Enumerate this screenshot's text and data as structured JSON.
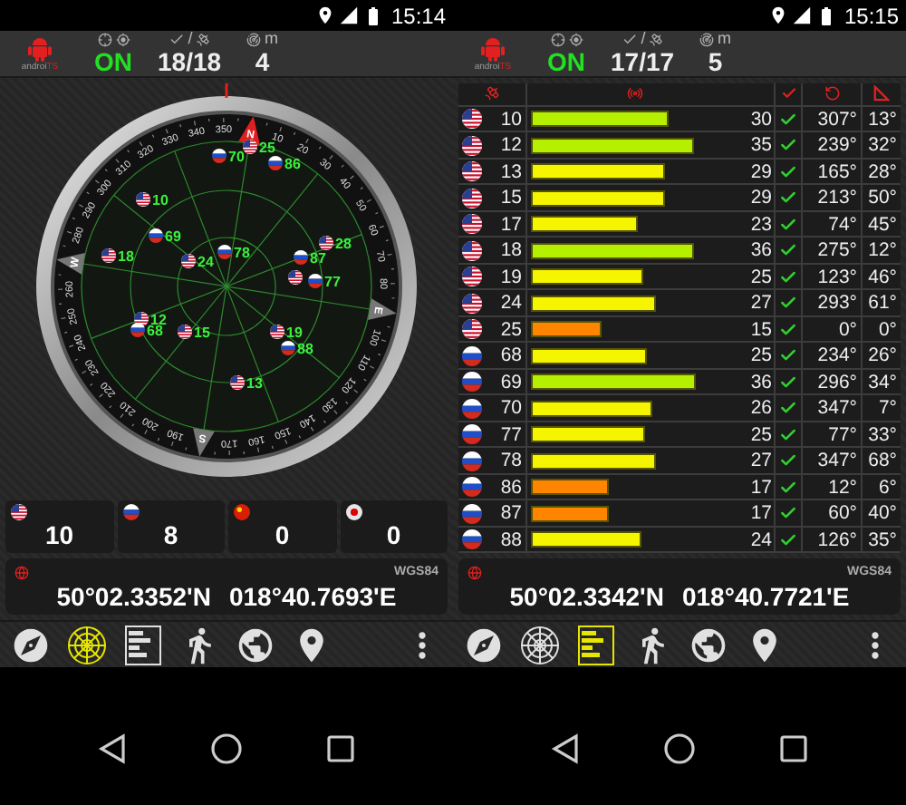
{
  "screens": [
    {
      "status": {
        "time": "15:14"
      },
      "header": {
        "logo": "androi",
        "logo_suffix": "TS",
        "fix": "ON",
        "separator": "/",
        "satellites": "18/18",
        "unit": "m",
        "accuracy": "4"
      },
      "view": {
        "kind": "radar",
        "dial": [
          "N",
          "10",
          "20",
          "30",
          "40",
          "50",
          "60",
          "70",
          "80",
          "E",
          "100",
          "110",
          "120",
          "130",
          "140",
          "150",
          "160",
          "170",
          "S",
          "190",
          "200",
          "210",
          "220",
          "230",
          "240",
          "250",
          "260",
          "W",
          "280",
          "290",
          "300",
          "310",
          "320",
          "330",
          "340",
          "350"
        ],
        "satellites": [
          {
            "label": "70",
            "kind": "ru"
          },
          {
            "label": "25",
            "kind": "us"
          },
          {
            "label": "86",
            "kind": "ru"
          },
          {
            "label": "10",
            "kind": "us"
          },
          {
            "label": "69",
            "kind": "ru"
          },
          {
            "label": "18",
            "kind": "us"
          },
          {
            "label": "24",
            "kind": "us"
          },
          {
            "label": "78",
            "kind": "ru"
          },
          {
            "label": "28",
            "kind": "us"
          },
          {
            "label": "87",
            "kind": "ru"
          },
          {
            "kind": "us"
          },
          {
            "label": "77",
            "kind": "ru"
          },
          {
            "label": "12",
            "kind": "us"
          },
          {
            "label": "68",
            "kind": "ru"
          },
          {
            "label": "15",
            "kind": "us"
          },
          {
            "label": "19",
            "kind": "us"
          },
          {
            "label": "88",
            "kind": "ru"
          },
          {
            "label": "13",
            "kind": "us"
          }
        ]
      },
      "counts": [
        {
          "kind": "us",
          "value": "10"
        },
        {
          "kind": "ru",
          "value": "8"
        },
        {
          "kind": "cn",
          "value": "0"
        },
        {
          "kind": "jp",
          "value": "0"
        }
      ],
      "position": {
        "datum": "WGS84",
        "latitude": "50°02.3352'N",
        "longitude": "018°40.7693'E"
      },
      "toolbar": [
        {
          "kind": "compass",
          "selected": false
        },
        {
          "kind": "radar",
          "selected": true
        },
        {
          "kind": "bars",
          "selected": false
        },
        {
          "kind": "walk",
          "selected": false
        },
        {
          "kind": "globe",
          "selected": false
        },
        {
          "kind": "pin",
          "selected": false
        },
        {
          "kind": "more",
          "selected": false
        }
      ]
    },
    {
      "status": {
        "time": "15:15"
      },
      "header": {
        "logo": "androi",
        "logo_suffix": "TS",
        "fix": "ON",
        "separator": "/",
        "satellites": "17/17",
        "unit": "m",
        "accuracy": "5"
      },
      "view": {
        "kind": "table",
        "rows": [
          {
            "kind": "us",
            "prn": "10",
            "level": 0.65,
            "color": "#b4f000",
            "snr": "30",
            "used": true,
            "azimuth": "307°",
            "elevation": "13°"
          },
          {
            "kind": "us",
            "prn": "12",
            "level": 0.77,
            "color": "#b4f000",
            "snr": "35",
            "used": true,
            "azimuth": "239°",
            "elevation": "32°"
          },
          {
            "kind": "us",
            "prn": "13",
            "level": 0.63,
            "color": "#f5f500",
            "snr": "29",
            "used": true,
            "azimuth": "165°",
            "elevation": "28°"
          },
          {
            "kind": "us",
            "prn": "15",
            "level": 0.63,
            "color": "#f5f500",
            "snr": "29",
            "used": true,
            "azimuth": "213°",
            "elevation": "50°"
          },
          {
            "kind": "us",
            "prn": "17",
            "level": 0.5,
            "color": "#f5f500",
            "snr": "23",
            "used": true,
            "azimuth": "74°",
            "elevation": "45°"
          },
          {
            "kind": "us",
            "prn": "18",
            "level": 0.77,
            "color": "#b4f000",
            "snr": "36",
            "used": true,
            "azimuth": "275°",
            "elevation": "12°"
          },
          {
            "kind": "us",
            "prn": "19",
            "level": 0.53,
            "color": "#f5f500",
            "snr": "25",
            "used": true,
            "azimuth": "123°",
            "elevation": "46°"
          },
          {
            "kind": "us",
            "prn": "24",
            "level": 0.59,
            "color": "#f5f500",
            "snr": "27",
            "used": true,
            "azimuth": "293°",
            "elevation": "61°"
          },
          {
            "kind": "us",
            "prn": "25",
            "level": 0.33,
            "color": "#ff8400",
            "snr": "15",
            "used": true,
            "azimuth": "0°",
            "elevation": "0°"
          },
          {
            "kind": "ru",
            "prn": "68",
            "level": 0.55,
            "color": "#f5f500",
            "snr": "25",
            "used": true,
            "azimuth": "234°",
            "elevation": "26°"
          },
          {
            "kind": "ru",
            "prn": "69",
            "level": 0.78,
            "color": "#b4f000",
            "snr": "36",
            "used": true,
            "azimuth": "296°",
            "elevation": "34°"
          },
          {
            "kind": "ru",
            "prn": "70",
            "level": 0.57,
            "color": "#f5f500",
            "snr": "26",
            "used": true,
            "azimuth": "347°",
            "elevation": "7°"
          },
          {
            "kind": "ru",
            "prn": "77",
            "level": 0.54,
            "color": "#f5f500",
            "snr": "25",
            "used": true,
            "azimuth": "77°",
            "elevation": "33°"
          },
          {
            "kind": "ru",
            "prn": "78",
            "level": 0.59,
            "color": "#f5f500",
            "snr": "27",
            "used": true,
            "azimuth": "347°",
            "elevation": "68°"
          },
          {
            "kind": "ru",
            "prn": "86",
            "level": 0.37,
            "color": "#ff8400",
            "snr": "17",
            "used": true,
            "azimuth": "12°",
            "elevation": "6°"
          },
          {
            "kind": "ru",
            "prn": "87",
            "level": 0.37,
            "color": "#ff8400",
            "snr": "17",
            "used": true,
            "azimuth": "60°",
            "elevation": "40°"
          },
          {
            "kind": "ru",
            "prn": "88",
            "level": 0.52,
            "color": "#f5f500",
            "snr": "24",
            "used": true,
            "azimuth": "126°",
            "elevation": "35°"
          }
        ]
      },
      "position": {
        "datum": "WGS84",
        "latitude": "50°02.3342'N",
        "longitude": "018°40.7721'E"
      },
      "toolbar": [
        {
          "kind": "compass",
          "selected": false
        },
        {
          "kind": "radar",
          "selected": false
        },
        {
          "kind": "bars",
          "selected": true
        },
        {
          "kind": "walk",
          "selected": false
        },
        {
          "kind": "globe",
          "selected": false
        },
        {
          "kind": "pin",
          "selected": false
        },
        {
          "kind": "more",
          "selected": false
        }
      ]
    }
  ]
}
